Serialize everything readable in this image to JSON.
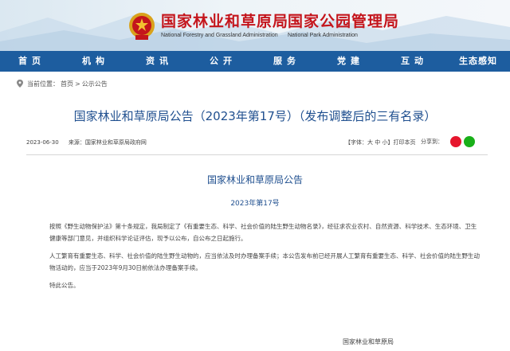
{
  "header": {
    "org1_cn": "国家林业和草原局",
    "org1_en": "National Forestry and Grassland Administration",
    "org2_cn": "国家公园管理局",
    "org2_en": "National Park Administration",
    "accent": "#c4151c"
  },
  "nav": {
    "items": [
      "首页",
      "机构",
      "资讯",
      "公开",
      "服务",
      "党建",
      "互动",
      "生态感知"
    ],
    "bg": "#1d5d9f"
  },
  "breadcrumb": {
    "label": "当前位置：",
    "home": "首页",
    "sep": ">",
    "current": "公示公告"
  },
  "article": {
    "title": "国家林业和草原局公告（2023年第17号）（发布调整后的三有名录）",
    "date": "2023-06-30",
    "source": "来源：国家林业和草原局政府网",
    "font_size": "【字体：大 中 小】打印本页",
    "share_label": "分享到：",
    "doc_title": "国家林业和草原局公告",
    "doc_no": "2023年第17号",
    "paragraphs": [
      "按照《野生动物保护法》第十条规定，我局制定了《有重要生态、科学、社会价值的陆生野生动物名录》，经征求农业农村、自然资源、科学技术、生态环境、卫生健康等部门意见，并组织科学论证评估，现予以公布，自公布之日起施行。",
      "人工繁育有重要生态、科学、社会价值的陆生野生动物的，应当依法及时办理备案手续；本公告发布前已经开展人工繁育有重要生态、科学、社会价值的陆生野生动物活动的，应当于2023年9月30日前依法办理备案手续。",
      "特此公告。"
    ],
    "signature": "国家林业和草原局"
  }
}
